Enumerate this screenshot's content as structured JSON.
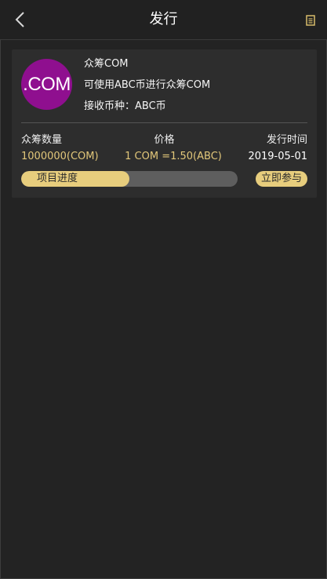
{
  "header": {
    "title": "发行",
    "back_icon": "chevron-left-icon",
    "doc_icon": "document-icon"
  },
  "offering": {
    "logo_text": ".COM",
    "logo_color": "#8f0f8f",
    "name": "众筹COM",
    "description": "可使用ABC币进行众筹COM",
    "accept_label": "接收币种：ABC币",
    "stats": {
      "quantity_label": "众筹数量",
      "price_label": "价格",
      "date_label": "发行时间",
      "quantity_value": "1000000(COM)",
      "price_value": "1 COM =1.50(ABC)",
      "date_value": "2019-05-01"
    },
    "progress": {
      "label": "项目进度",
      "fraction": 0.5
    },
    "join_label": "立即参与"
  },
  "colors": {
    "accent": "#e7cd7d",
    "background": "#232323",
    "card": "#2d2d2d"
  }
}
